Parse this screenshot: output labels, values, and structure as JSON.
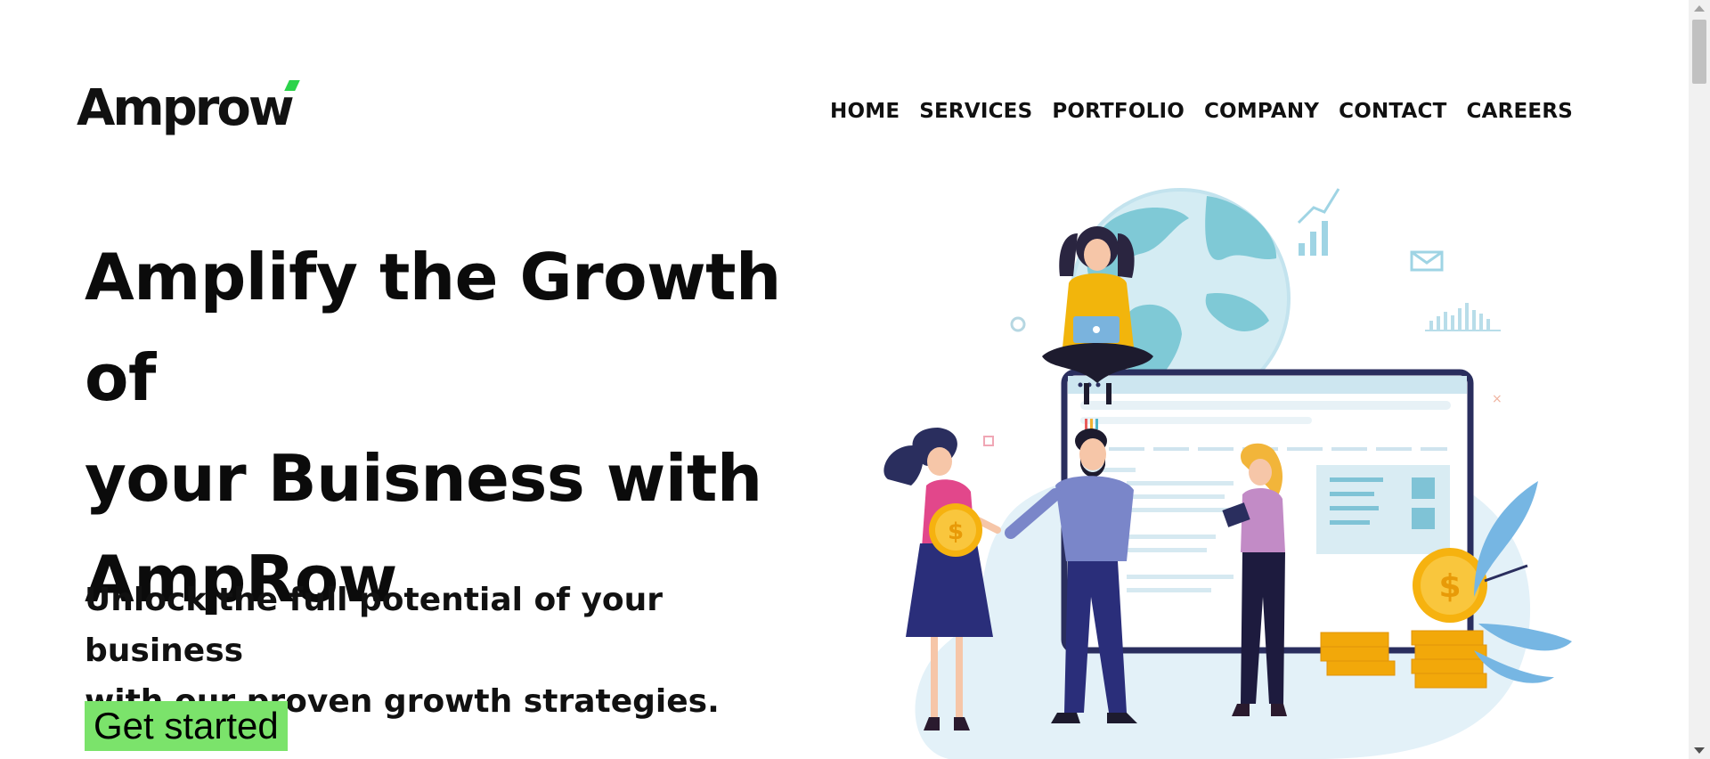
{
  "brand": {
    "logo_text": "Amprow",
    "accent_color": "#2bd34a"
  },
  "nav": {
    "items": [
      {
        "label": "HOME"
      },
      {
        "label": "SERVICES"
      },
      {
        "label": "PORTFOLIO"
      },
      {
        "label": "COMPANY"
      },
      {
        "label": "CONTACT"
      },
      {
        "label": "CAREERS"
      }
    ]
  },
  "hero": {
    "title_line1": "Amplify the Growth of",
    "title_line2": "your Buisness with",
    "title_line3": "AmpRow",
    "subtitle_line1": "Unlock the full potential of your business",
    "subtitle_line2": "with our proven growth strategies.",
    "cta_label": "Get started",
    "cta_color": "#7be36b"
  },
  "illustration": {
    "icon": "business-growth-illustration",
    "coin_symbol": "$"
  }
}
